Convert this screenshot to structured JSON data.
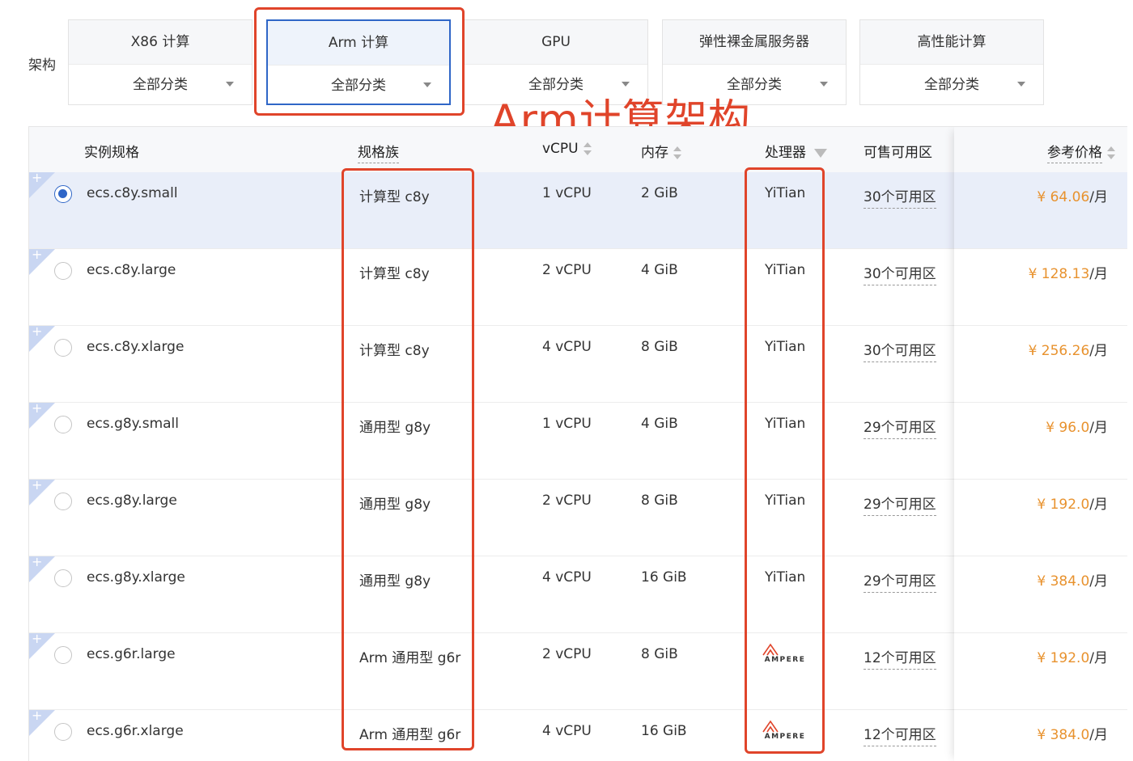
{
  "architecture_label": "架构",
  "categories": [
    {
      "name": "X86 计算",
      "filter": "全部分类"
    },
    {
      "name": "Arm 计算",
      "filter": "全部分类"
    },
    {
      "name": "GPU",
      "filter": "全部分类"
    },
    {
      "name": "弹性裸金属服务器",
      "filter": "全部分类"
    },
    {
      "name": "高性能计算",
      "filter": "全部分类"
    }
  ],
  "annotation": "Arm计算架构",
  "table": {
    "headers": {
      "spec": "实例规格",
      "family": "规格族",
      "vcpu": "vCPU",
      "memory": "内存",
      "processor": "处理器",
      "zones": "可售可用区",
      "price": "参考价格"
    },
    "rows": [
      {
        "spec": "ecs.c8y.small",
        "family": "计算型 c8y",
        "vcpu": "1 vCPU",
        "memory": "2 GiB",
        "processor": "YiTian",
        "zones": "30个可用区",
        "price": "¥ 64.06",
        "unit": "/月",
        "selected": true
      },
      {
        "spec": "ecs.c8y.large",
        "family": "计算型 c8y",
        "vcpu": "2 vCPU",
        "memory": "4 GiB",
        "processor": "YiTian",
        "zones": "30个可用区",
        "price": "¥ 128.13",
        "unit": "/月"
      },
      {
        "spec": "ecs.c8y.xlarge",
        "family": "计算型 c8y",
        "vcpu": "4 vCPU",
        "memory": "8 GiB",
        "processor": "YiTian",
        "zones": "30个可用区",
        "price": "¥ 256.26",
        "unit": "/月"
      },
      {
        "spec": "ecs.g8y.small",
        "family": "通用型 g8y",
        "vcpu": "1 vCPU",
        "memory": "4 GiB",
        "processor": "YiTian",
        "zones": "29个可用区",
        "price": "¥ 96.0",
        "unit": "/月"
      },
      {
        "spec": "ecs.g8y.large",
        "family": "通用型 g8y",
        "vcpu": "2 vCPU",
        "memory": "8 GiB",
        "processor": "YiTian",
        "zones": "29个可用区",
        "price": "¥ 192.0",
        "unit": "/月"
      },
      {
        "spec": "ecs.g8y.xlarge",
        "family": "通用型 g8y",
        "vcpu": "4 vCPU",
        "memory": "16 GiB",
        "processor": "YiTian",
        "zones": "29个可用区",
        "price": "¥ 384.0",
        "unit": "/月"
      },
      {
        "spec": "ecs.g6r.large",
        "family": "Arm 通用型 g6r",
        "vcpu": "2 vCPU",
        "memory": "8 GiB",
        "processor": "AMPERE",
        "processor_logo": true,
        "zones": "12个可用区",
        "price": "¥ 192.0",
        "unit": "/月"
      },
      {
        "spec": "ecs.g6r.xlarge",
        "family": "Arm 通用型 g6r",
        "vcpu": "4 vCPU",
        "memory": "16 GiB",
        "processor": "AMPERE",
        "processor_logo": true,
        "zones": "12个可用区",
        "price": "¥ 384.0",
        "unit": "/月"
      }
    ]
  },
  "colors": {
    "accent": "#2f66c7",
    "highlight": "#e0442a",
    "price": "#e8922e"
  }
}
